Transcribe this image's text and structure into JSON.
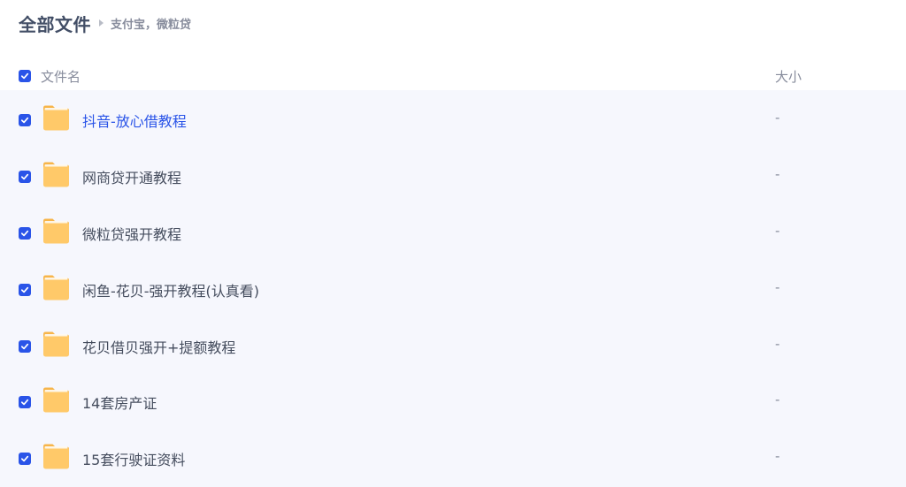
{
  "breadcrumb": {
    "title": "全部文件",
    "current": "支付宝，微粒贷"
  },
  "header": {
    "name_label": "文件名",
    "size_label": "大小",
    "select_all_checked": true
  },
  "icons": {
    "checkbox": "checkmark-icon",
    "folder": "folder-icon",
    "separator": "chevron-right-icon"
  },
  "colors": {
    "accent": "#2a54e8",
    "folder": "#ffc969",
    "row_background": "#f6f7fd"
  },
  "files": [
    {
      "name": "抖音-放心借教程",
      "size": "-",
      "checked": true,
      "active": true
    },
    {
      "name": "网商贷开通教程",
      "size": "-",
      "checked": true,
      "active": false
    },
    {
      "name": "微粒贷强开教程",
      "size": "-",
      "checked": true,
      "active": false
    },
    {
      "name": "闲鱼-花贝-强开教程(认真看)",
      "size": "-",
      "checked": true,
      "active": false
    },
    {
      "name": "花贝借贝强开+提额教程",
      "size": "-",
      "checked": true,
      "active": false
    },
    {
      "name": "14套房产证",
      "size": "-",
      "checked": true,
      "active": false
    },
    {
      "name": "15套行驶证资料",
      "size": "-",
      "checked": true,
      "active": false
    }
  ]
}
